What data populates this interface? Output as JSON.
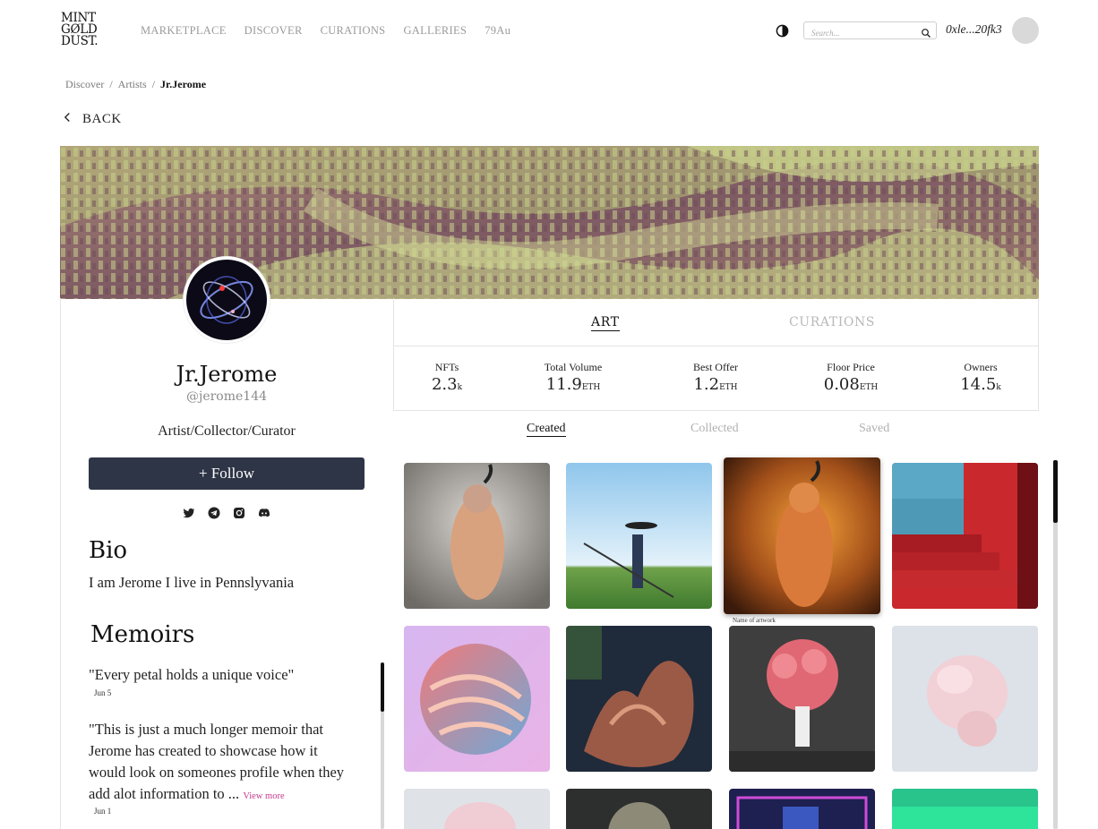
{
  "header": {
    "logo": [
      "MINT",
      "GØLD",
      "DUST."
    ],
    "nav": [
      "MARKETPLACE",
      "DISCOVER",
      "CURATIONS",
      "GALLERIES",
      "79Au"
    ],
    "search_placeholder": "Search...",
    "wallet": "0xle...20fk3"
  },
  "breadcrumb": {
    "items": [
      "Discover",
      "Artists"
    ],
    "separator": "/",
    "current": "Jr.Jerome"
  },
  "back_label": "BACK",
  "profile": {
    "name": "Jr.Jerome",
    "handle": "@jerome144",
    "role": "Artist/Collector/Curator",
    "follow_label": "+ Follow",
    "socials": [
      "twitter-icon",
      "telegram-icon",
      "instagram-icon",
      "discord-icon"
    ]
  },
  "bio": {
    "heading": "Bio",
    "text": "I am Jerome I live in Pennslyvania"
  },
  "memoirs": {
    "heading": "Memoirs",
    "items": [
      {
        "text": "\"Every petal holds a unique voice\"",
        "date": "Jun 5"
      },
      {
        "text": "\"This is just a much longer memoir that Jerome has created to showcase how it would look on someones profile when they add alot information to ...",
        "more": "View more",
        "date": "Jun 1"
      }
    ]
  },
  "tabs": {
    "art": "ART",
    "curations": "CURATIONS"
  },
  "stats": [
    {
      "label": "NFTs",
      "value": "2.3",
      "unit": "k"
    },
    {
      "label": "Total Volume",
      "value": "11.9",
      "unit": "ETH"
    },
    {
      "label": "Best Offer",
      "value": "1.2",
      "unit": "ETH"
    },
    {
      "label": "Floor Price",
      "value": "0.08",
      "unit": "ETH"
    },
    {
      "label": "Owners",
      "value": "14.5",
      "unit": "k"
    }
  ],
  "subtabs": [
    "Created",
    "Collected",
    "Saved"
  ],
  "hover_caption": "Name of artwork",
  "colors": {
    "follow_bg": "#2e3546",
    "view_more": "#c7398f"
  }
}
